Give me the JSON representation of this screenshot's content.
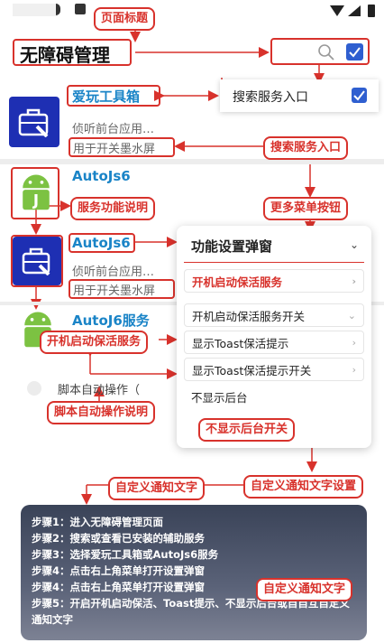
{
  "callouts": {
    "page_title": "页面标题",
    "search_entry_top": "搜索服务入口",
    "service_desc": "服务功能说明",
    "more_menu": "更多菜单按钮",
    "boot_keepalive": "开机启动保活服务",
    "script_desc": "脚本自动操作说明",
    "no_background_switch": "不显示后台开关",
    "custom_notify_text": "自定义通知文字",
    "custom_notify_setting": "自定义通知文字设置",
    "custom_notify_text_2": "自定义通知文字"
  },
  "header": {
    "title": "无障碍管理",
    "search_icon": "search-icon",
    "checkbox_icon": "checkbox-icon"
  },
  "search_popup": {
    "label": "搜索服务入口"
  },
  "apps": [
    {
      "name": "爱玩工具箱",
      "sub1": "侦听前台应用…",
      "sub2": "用于开关墨水屏",
      "icon": "toolbox-icon"
    },
    {
      "name": "AutoJs6",
      "icon": "android-icon"
    },
    {
      "name": "AutoJs6",
      "sub1": "侦听前台应用…",
      "sub2": "用于开关墨水屏",
      "icon": "toolbox-icon"
    },
    {
      "name": "AutoJ6服务",
      "icon": "android-icon"
    }
  ],
  "script_item": {
    "label": "脚本自动操作（"
  },
  "menu": {
    "title": "功能设置弹窗",
    "items": [
      "开机启动保活服务",
      "开机启动保活服务开关",
      "显示Toast保活提示",
      "显示Toast保活提示开关",
      "不显示后台"
    ]
  },
  "steps": [
    "步骤1：进入无障碍管理页面",
    "步骤2：搜索或查看已安装的辅助服务",
    "步骤3：选择爱玩工具箱或AutoJs6服务",
    "步骤4：点击右上角菜单打开设置弹窗",
    "步骤4：点击右上角菜单打开设置弹窗",
    "步骤5：开启开机启动保活、Toast提示、不显示后台或自自互自定义通知文字"
  ],
  "colors": {
    "accent": "#d8322c",
    "link": "#1a84c7",
    "icon_bg": "#1e2fb3",
    "android": "#7cc242"
  }
}
